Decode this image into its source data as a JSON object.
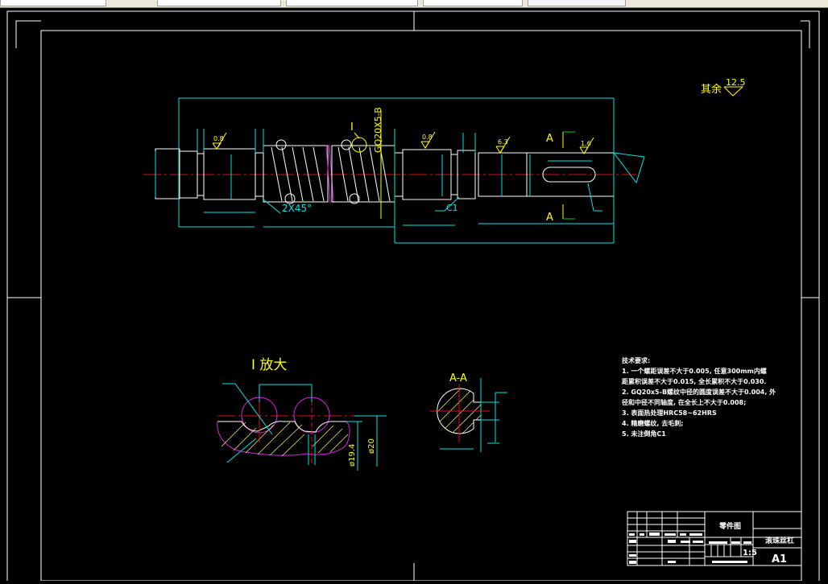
{
  "colors": {
    "background": "#000000",
    "frame": "#ffffff",
    "dimension": "#00e5e5",
    "annotation": "#ffff00",
    "centerline": "#e01010",
    "break": "#e020e0"
  },
  "drawing": {
    "roughness_other_label": "其余",
    "roughness_other_value": "12.5",
    "roughness": [
      "0.8",
      "0.8",
      "6.3",
      "1.6"
    ],
    "detail_mark": "I",
    "thread_spec": "GQ20X5-B",
    "chamfer_thread": "2X45°",
    "chamfer": "C1",
    "section_mark": "A",
    "detail_view_title": "I 放大",
    "section_view_title": "A-A",
    "dia_root": "ø19.4",
    "dia_outer": "ø20"
  },
  "tech_requirements": {
    "title": "技术要求:",
    "lines": [
      "1. 一个螺距误差不大于0.005, 任意300mm内螺",
      "距累积误差不大于0.015, 全长累积不大于0.030.",
      "2. GQ20x5-B螺纹中径的圆度误差不大于0.004, 外",
      "径和中径不同轴度, 在全长上不大于0.008;",
      "3. 表面热处理HRC58~62HRS",
      "4. 精磨螺纹, 去毛刺;",
      "5. 未注倒角C1"
    ]
  },
  "title_block": {
    "drawing_type": "零件图",
    "part_name": "滚珠丝杠",
    "scale": "1:5",
    "sheet_size": "A1"
  }
}
